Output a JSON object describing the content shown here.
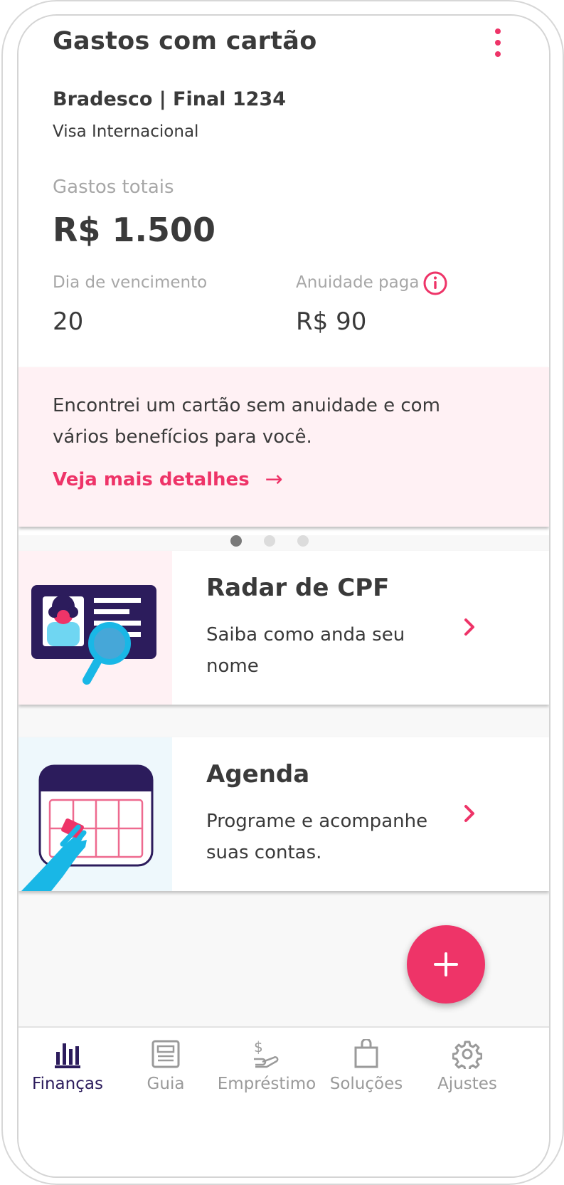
{
  "card": {
    "title": "Gastos com cartão",
    "bank": "Bradesco | Final 1234",
    "card_type": "Visa Internacional",
    "total_label": "Gastos totais",
    "total_value": "R$ 1.500",
    "due_label": "Dia de vencimento",
    "due_value": "20",
    "fee_label": "Anuidade paga",
    "fee_value": "R$ 90",
    "menu_icon": "kebab-menu-icon",
    "info_icon": "info-icon"
  },
  "promo": {
    "text": "Encontrei um cartão sem anuidade e com vários benefícios para você.",
    "link_label": "Veja mais detalhes",
    "link_icon": "arrow-right-icon"
  },
  "carousel": {
    "pages": 3,
    "active_index": 0
  },
  "features": [
    {
      "title": "Radar de CPF",
      "description": "Saiba como anda seu nome",
      "icon": "id-card-magnifier-illustration"
    },
    {
      "title": "Agenda",
      "description": "Programe e acompanhe suas contas.",
      "icon": "calendar-hand-illustration"
    }
  ],
  "fab": {
    "icon": "plus-icon"
  },
  "nav": {
    "items": [
      {
        "label": "Finanças",
        "icon": "bar-chart-icon",
        "active": true
      },
      {
        "label": "Guia",
        "icon": "newspaper-icon",
        "active": false
      },
      {
        "label": "Empréstimo",
        "icon": "money-hand-icon",
        "active": false
      },
      {
        "label": "Soluções",
        "icon": "shopping-bag-icon",
        "active": false
      },
      {
        "label": "Ajustes",
        "icon": "gear-icon",
        "active": false
      }
    ]
  },
  "colors": {
    "accent": "#ee3468",
    "dark_purple": "#2c1c5c",
    "promo_bg": "#fff1f4",
    "agenda_bg": "#eef8fc",
    "illustration_blue": "#19b7e6",
    "text_dark": "#3a3a3a",
    "text_muted": "#a7a7a7"
  }
}
